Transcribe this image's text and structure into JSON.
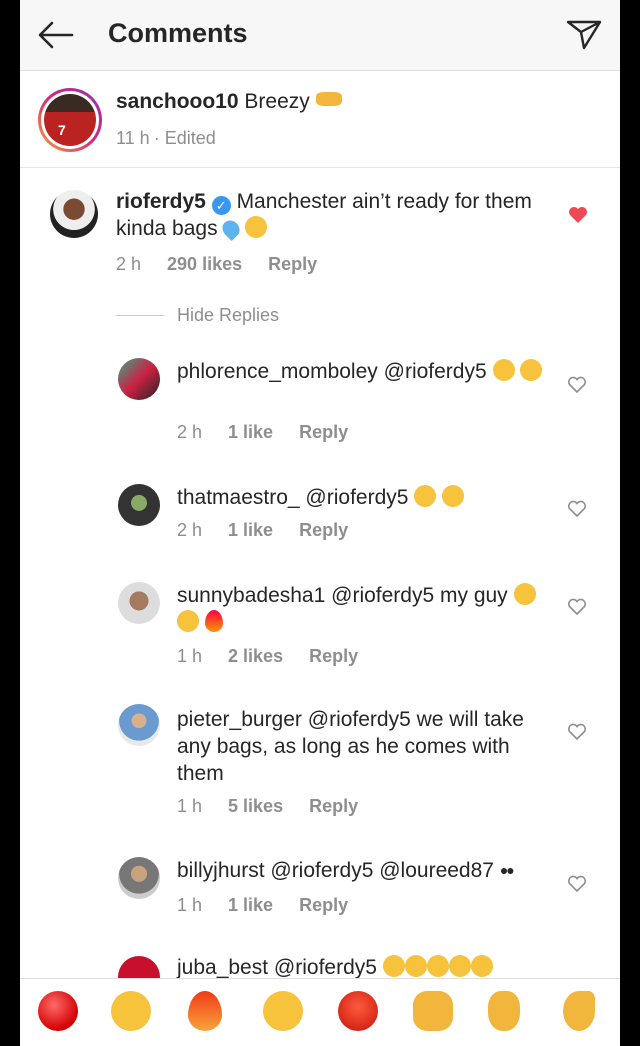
{
  "header": {
    "title": "Comments"
  },
  "caption": {
    "username": "sanchooo10",
    "text": "Breezy",
    "time": "11 h",
    "edited": "· Edited"
  },
  "main_comment": {
    "username": "rioferdy5",
    "text": "Manchester ain’t ready for them kinda bags",
    "time": "2 h",
    "likes": "290 likes",
    "reply": "Reply"
  },
  "hide_replies": "Hide Replies",
  "replies": [
    {
      "username": "phlorence_momboley",
      "text": "@rioferdy5",
      "time": "2 h",
      "likes": "1 like",
      "reply": "Reply"
    },
    {
      "username": "thatmaestro_",
      "text": "@rioferdy5",
      "time": "2 h",
      "likes": "1 like",
      "reply": "Reply"
    },
    {
      "username": "sunnybadesha1",
      "text": "@rioferdy5 my guy",
      "time": "1 h",
      "likes": "2 likes",
      "reply": "Reply"
    },
    {
      "username": "pieter_burger",
      "text": "@rioferdy5 we will take any bags, as long as he comes with them",
      "time": "1 h",
      "likes": "5 likes",
      "reply": "Reply"
    },
    {
      "username": "billyjhurst",
      "text": "@rioferdy5 @loureed87",
      "time": "1 h",
      "likes": "1 like",
      "reply": "Reply"
    },
    {
      "username": "juba_best",
      "text": "@rioferdy5"
    }
  ],
  "colors": {
    "heart_liked": "#ed4956",
    "verified": "#3897f0",
    "meta": "#8e8e8e"
  }
}
